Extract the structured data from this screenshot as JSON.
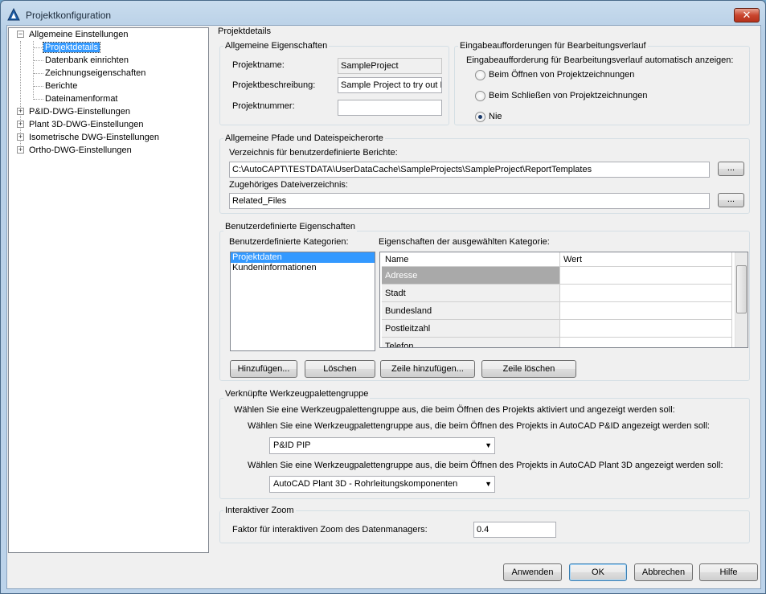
{
  "window": {
    "title": "Projektkonfiguration",
    "close_glyph": "✕"
  },
  "tree": {
    "items": [
      {
        "label": "Allgemeine Einstellungen",
        "expander": "−"
      },
      {
        "label": "Projektdetails"
      },
      {
        "label": "Datenbank einrichten"
      },
      {
        "label": "Zeichnungseigenschaften"
      },
      {
        "label": "Berichte"
      },
      {
        "label": "Dateinamenformat"
      },
      {
        "label": "P&ID-DWG-Einstellungen",
        "expander": "+"
      },
      {
        "label": "Plant 3D-DWG-Einstellungen",
        "expander": "+"
      },
      {
        "label": "Isometrische DWG-Einstellungen",
        "expander": "+"
      },
      {
        "label": "Ortho-DWG-Einstellungen",
        "expander": "+"
      }
    ]
  },
  "panel": {
    "title": "Projektdetails",
    "general": {
      "title": "Allgemeine Eigenschaften",
      "name_label": "Projektname:",
      "name_value": "SampleProject",
      "desc_label": "Projektbeschreibung:",
      "desc_value": "Sample Project to try out F",
      "number_label": "Projektnummer:",
      "number_value": ""
    },
    "prompts": {
      "title": "Eingabeaufforderungen für Bearbeitungsverlauf",
      "question": "Eingabeaufforderung für Bearbeitungsverlauf automatisch anzeigen:",
      "options": [
        "Beim Öffnen von Projektzeichnungen",
        "Beim Schließen von Projektzeichnungen",
        "Nie"
      ]
    },
    "paths": {
      "title": "Allgemeine Pfade und Dateispeicherorte",
      "reports_label": "Verzeichnis für benutzerdefinierte Berichte:",
      "reports_value": "C:\\AutoCAPT\\TESTDATA\\UserDataCache\\SampleProjects\\SampleProject\\ReportTemplates",
      "related_label": "Zugehöriges Dateiverzeichnis:",
      "related_value": "Related_Files",
      "browse_label": "..."
    },
    "custom": {
      "title": "Benutzerdefinierte Eigenschaften",
      "categories_label": "Benutzerdefinierte Kategorien:",
      "categories": [
        "Projektdaten",
        "Kundeninformationen"
      ],
      "props_label": "Eigenschaften der ausgewählten Kategorie:",
      "col_name": "Name",
      "col_value": "Wert",
      "rows": [
        "Adresse",
        "Stadt",
        "Bundesland",
        "Postleitzahl",
        "Telefon"
      ],
      "add_label": "Hinzufügen...",
      "delete_label": "Löschen",
      "add_row_label": "Zeile hinzufügen...",
      "delete_row_label": "Zeile löschen"
    },
    "palette": {
      "title": "Verknüpfte Werkzeugpalettengruppe",
      "intro": "Wählen Sie eine Werkzeugpalettengruppe aus, die beim Öffnen des Projekts aktiviert und angezeigt werden soll:",
      "pid_label": "Wählen Sie eine Werkzeugpalettengruppe aus, die beim Öffnen des Projekts in AutoCAD P&ID angezeigt werden soll:",
      "pid_value": "P&ID PIP",
      "plant_label": "Wählen Sie eine Werkzeugpalettengruppe aus, die beim Öffnen des Projekts in AutoCAD Plant 3D angezeigt werden soll:",
      "plant_value": "AutoCAD Plant 3D - Rohrleitungskomponenten"
    },
    "zoom": {
      "title": "Interaktiver Zoom",
      "label": "Faktor für interaktiven Zoom des Datenmanagers:",
      "value": "0.4"
    }
  },
  "footer": {
    "apply": "Anwenden",
    "ok": "OK",
    "cancel": "Abbrechen",
    "help": "Hilfe"
  }
}
